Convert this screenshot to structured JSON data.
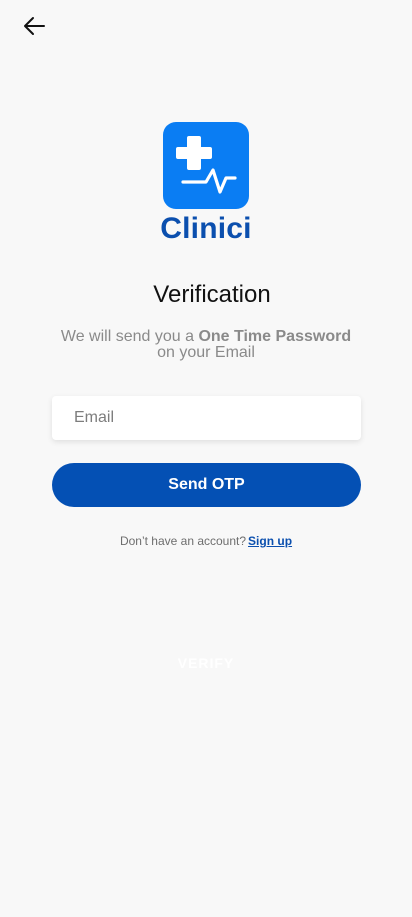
{
  "header": {
    "back_icon": "arrow-left-icon"
  },
  "brand": {
    "logo_icon": "medical-cross-heartbeat-icon",
    "name": "Clinici",
    "color": "#0b4fae",
    "tile_color": "#0a7df3"
  },
  "verification": {
    "title": "Verification",
    "subtitle_prefix": "We will send you a ",
    "subtitle_bold": "One Time Password",
    "subtitle_suffix": "on your Email"
  },
  "form": {
    "email_placeholder": "Email",
    "email_value": "",
    "send_button_label": "Send OTP",
    "send_button_color": "#0450b4"
  },
  "footer": {
    "prompt_text": "Don’t have an account?",
    "signup_link": "Sign up",
    "verify_label": "VERIFY"
  }
}
